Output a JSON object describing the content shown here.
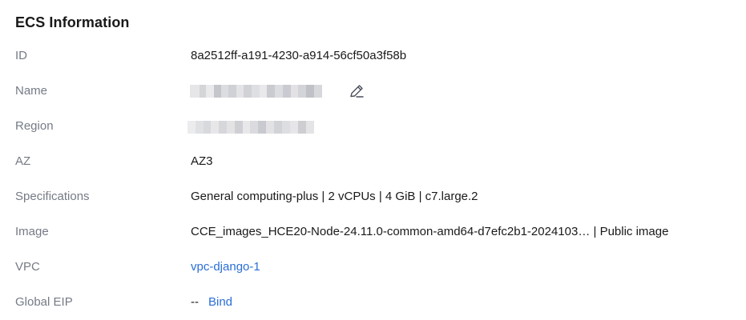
{
  "section": {
    "title": "ECS Information"
  },
  "fields": {
    "id": {
      "label": "ID",
      "value": "8a2512ff-a191-4230-a914-56cf50a3f58b"
    },
    "name": {
      "label": "Name",
      "edit_icon": "pencil-edit-icon"
    },
    "region": {
      "label": "Region"
    },
    "az": {
      "label": "AZ",
      "value": "AZ3"
    },
    "specifications": {
      "label": "Specifications",
      "value": "General computing-plus | 2 vCPUs | 4 GiB | c7.large.2"
    },
    "image": {
      "label": "Image",
      "name": "CCE_images_HCE20-Node-24.11.0-common-amd64-d7efc2b1-2024103…",
      "separator": " | ",
      "type": "Public image"
    },
    "vpc": {
      "label": "VPC",
      "value": "vpc-django-1"
    },
    "global_eip": {
      "label": "Global EIP",
      "value": "--",
      "action": "Bind"
    }
  },
  "colors": {
    "label": "#757a85",
    "value": "#191919",
    "link": "#2a6fd6"
  }
}
